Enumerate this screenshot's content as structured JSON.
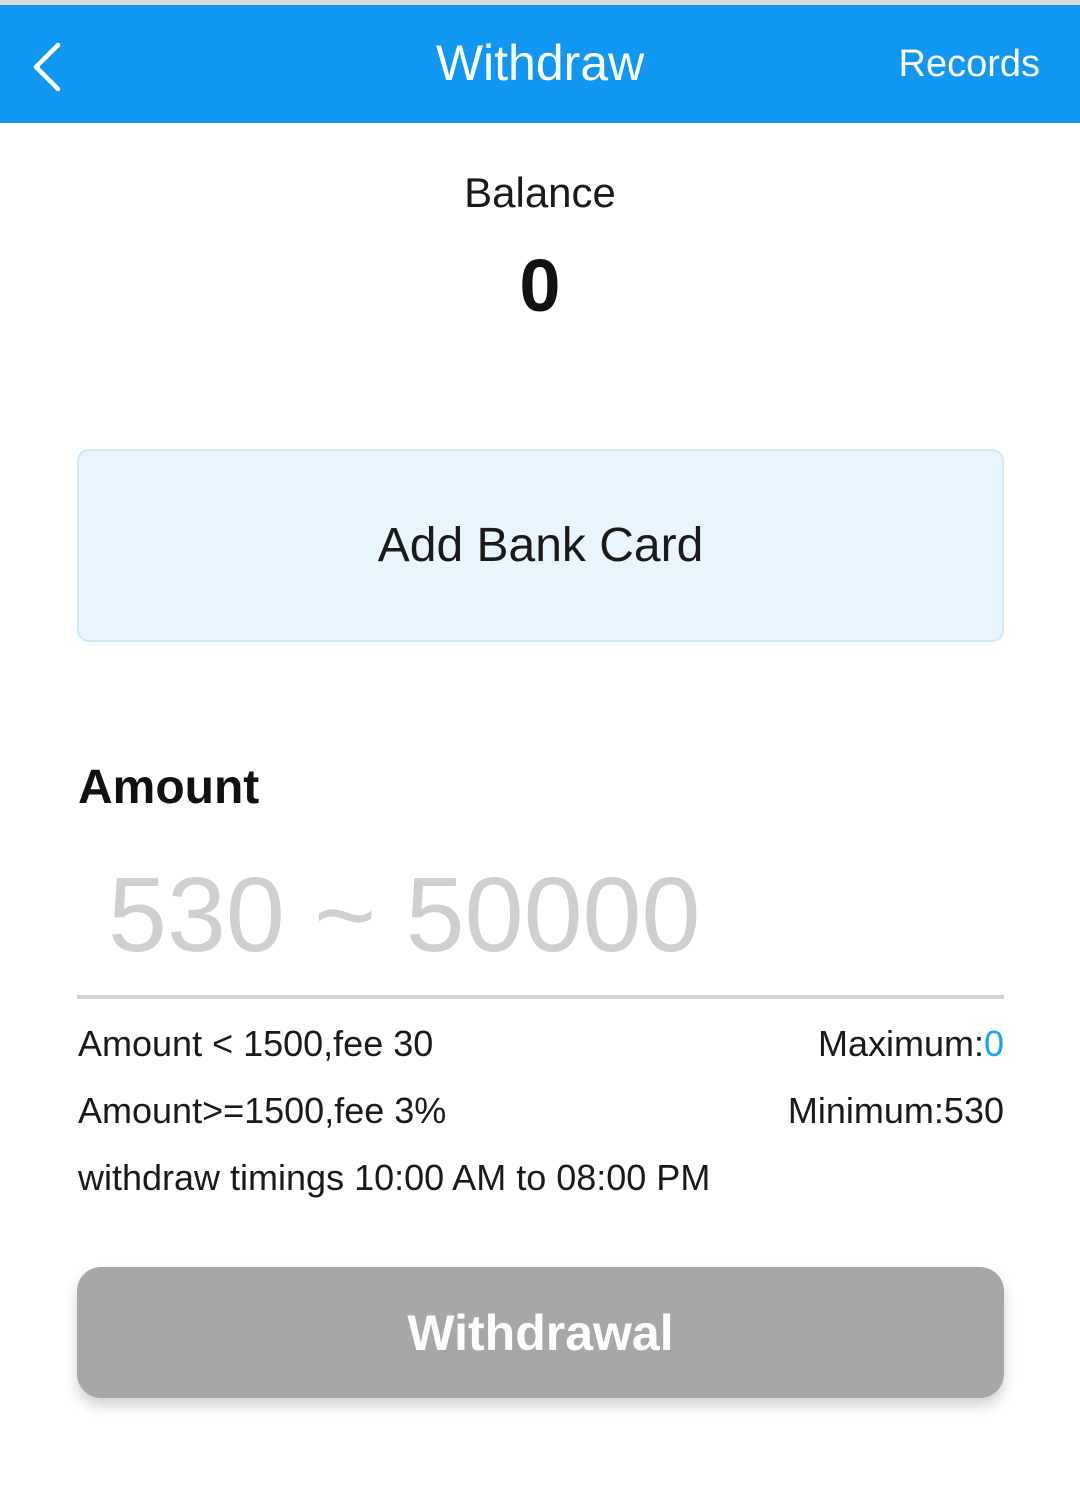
{
  "header": {
    "title": "Withdraw",
    "records_label": "Records",
    "back_icon": "chevron-left-icon",
    "background_color": "#0f97f2"
  },
  "balance": {
    "label": "Balance",
    "value": "0"
  },
  "bank_card": {
    "add_label": "Add Bank Card"
  },
  "amount": {
    "label": "Amount",
    "placeholder": "530 ~ 50000",
    "value": ""
  },
  "fees": {
    "rule_low": "Amount < 1500,fee 30",
    "rule_high": "Amount>=1500,fee 3%",
    "timings": "withdraw timings 10:00 AM to 08:00 PM"
  },
  "limits": {
    "maximum_label": "Maximum:",
    "maximum_value": "0",
    "minimum_label": "Minimum:",
    "minimum_value": "530"
  },
  "submit": {
    "label": "Withdrawal"
  },
  "colors": {
    "accent": "#12a7f0",
    "button_disabled": "#a7a7a7",
    "card_bg": "#e8f5fd"
  }
}
